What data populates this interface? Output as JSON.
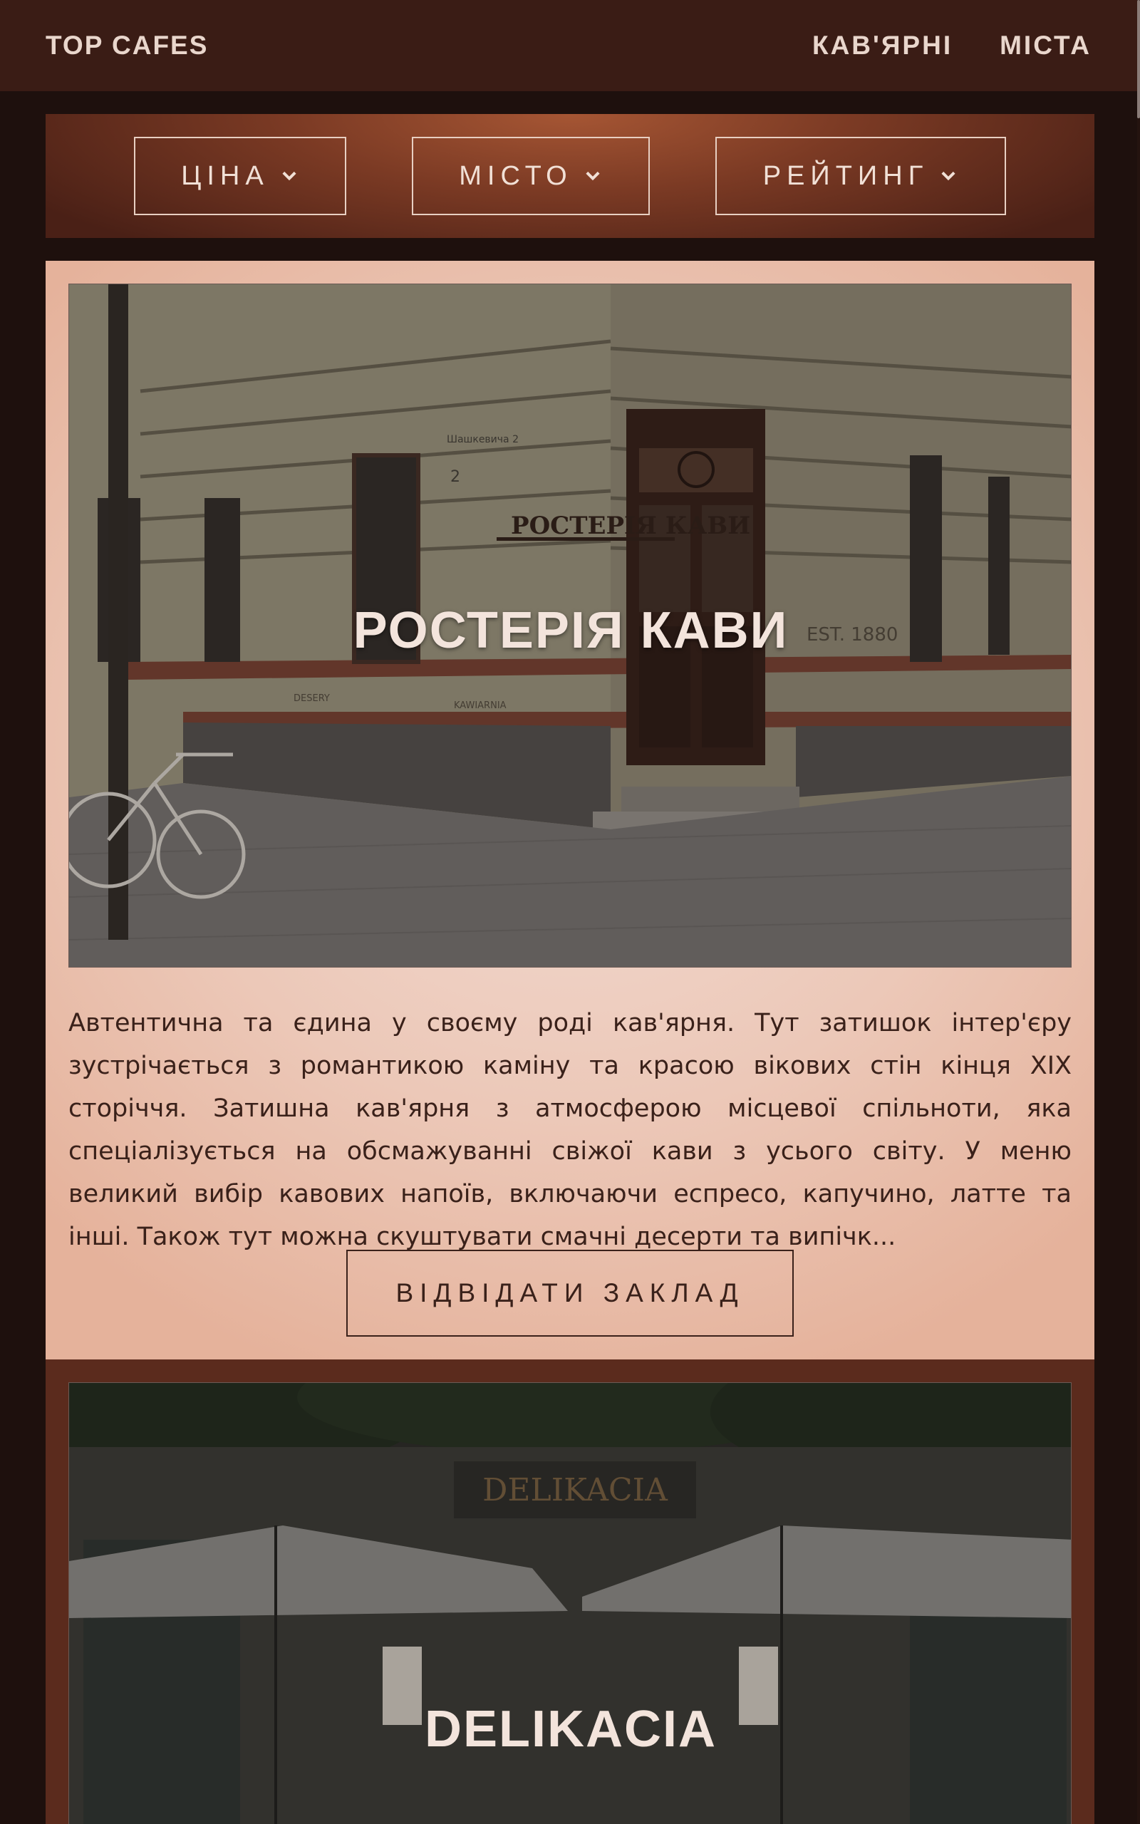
{
  "header": {
    "brand": "TOP CAFES",
    "nav": [
      "КАВ'ЯРНІ",
      "МІСТА"
    ]
  },
  "filters": [
    {
      "label": "ЦІНА"
    },
    {
      "label": "МІСТО"
    },
    {
      "label": "РЕЙТИНГ"
    }
  ],
  "cards": [
    {
      "title": "РОСТЕРІЯ КАВИ",
      "description": "Автентична та єдина у своєму роді кав'ярня. Тут затишок інтер'єру зустрічається з романтикою каміну та красою вікових стін кінця XIX сторіччя. Затишна кав'ярня з атмосферою місцевої спільноти, яка спеціалізується на обсмажуванні свіжої кави з усього світу. У меню великий вибір кавових напоїв, включаючи еспресо, капучино, латте та інші. Також тут можна скуштувати смачні десерти та випічк...",
      "button": "ВІДВІДАТИ ЗАКЛАД",
      "image": {
        "sign": "РОСТЕРІЯ КАВИ",
        "street": "Шашкевича 2",
        "number": "2",
        "est": "EST. 1880",
        "signs": [
          "DESERY",
          "KAWIARNIA"
        ]
      }
    },
    {
      "title": "DELIKACIA",
      "image": {
        "sign": "DELIKACIA"
      }
    }
  ]
}
